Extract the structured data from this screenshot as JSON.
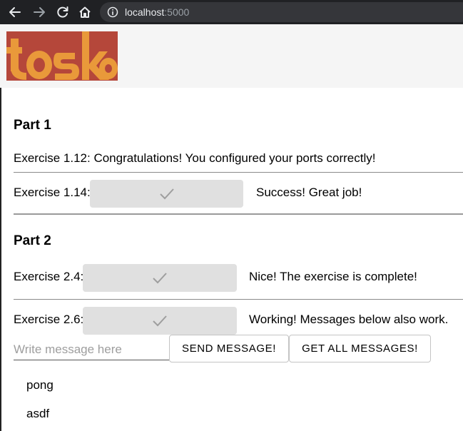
{
  "browser": {
    "url_host": "localhost",
    "url_port": ":5000",
    "icons": [
      "back-arrow-icon",
      "forward-arrow-icon",
      "reload-icon",
      "home-icon",
      "info-icon"
    ]
  },
  "header": {
    "logo_text": "toska",
    "colors": {
      "logo_red": "#b5473a",
      "logo_orange": "#e9993a",
      "header_bg": "#f5f5f5"
    }
  },
  "part1": {
    "heading": "Part 1",
    "ex112_text": "Exercise 1.12: Congratulations! You configured your ports correctly!",
    "ex114_label": "Exercise 1.14:",
    "ex114_status": "Success! Great job!"
  },
  "part2": {
    "heading": "Part 2",
    "ex24_label": "Exercise 2.4:",
    "ex24_status": "Nice! The exercise is complete!",
    "ex26_label": "Exercise 2.6:",
    "ex26_status": "Working! Messages below also work."
  },
  "messages": {
    "input_placeholder": "Write message here",
    "input_value": "",
    "send_label": "SEND MESSAGE!",
    "get_all_label": "GET ALL MESSAGES!",
    "items": [
      "pong",
      "asdf"
    ]
  }
}
